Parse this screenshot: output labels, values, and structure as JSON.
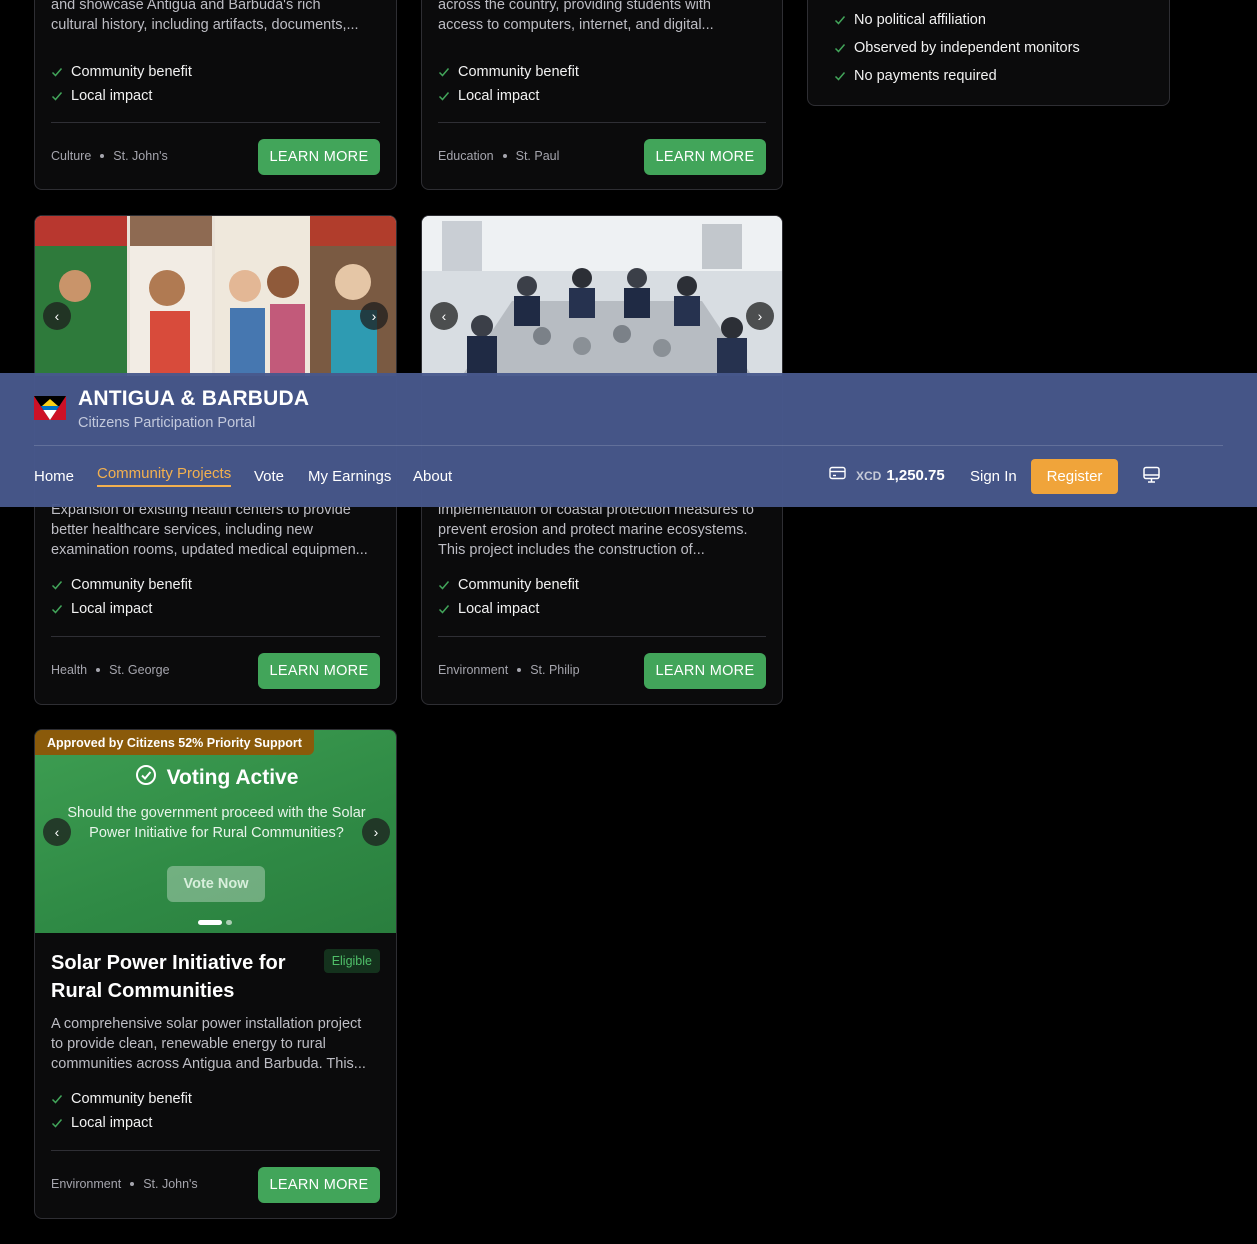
{
  "header": {
    "title": "ANTIGUA & BARBUDA",
    "subtitle": "Citizens Participation Portal",
    "nav": [
      "Home",
      "Community Projects",
      "Vote",
      "My Earnings",
      "About"
    ],
    "active_nav": "Community Projects",
    "balance_currency": "XCD",
    "balance_amount": "1,250.75",
    "sign_in": "Sign In",
    "register": "Register"
  },
  "benefits": [
    "Community benefit",
    "Local impact"
  ],
  "learn_more": "LEARN MORE",
  "side_panel": {
    "items": [
      "No political affiliation",
      "Observed by independent monitors",
      "No payments required"
    ]
  },
  "cards": [
    {
      "desc_lines": [
        "and showcase Antigua and Barbuda's rich",
        "cultural history, including artifacts, documents,..."
      ],
      "category": "Culture",
      "parish": "St. John's"
    },
    {
      "desc_lines": [
        "across the country, providing students with",
        "access to computers, internet, and digital..."
      ],
      "category": "Education",
      "parish": "St. Paul"
    },
    {
      "desc_lines": [
        "Expansion of existing health centers to provide",
        "better healthcare services, including new",
        "examination rooms, updated medical equipmen..."
      ],
      "category": "Health",
      "parish": "St. George"
    },
    {
      "desc_lines": [
        "implementation of coastal protection measures to",
        "prevent erosion and protect marine ecosystems.",
        "This project includes the construction of..."
      ],
      "category": "Environment",
      "parish": "St. Philip"
    },
    {
      "title": "Solar Power Initiative for Rural Communities",
      "badge": "Eligible",
      "desc_lines": [
        "A comprehensive solar power installation project",
        "to provide clean, renewable energy to rural",
        "communities across Antigua and Barbuda. This..."
      ],
      "category": "Environment",
      "parish": "St. John's",
      "approval_banner": "Approved by Citizens 52% Priority Support",
      "voting_title": "Voting Active",
      "voting_question": "Should the government proceed with the Solar Power Initiative for Rural Communities?",
      "vote_button": "Vote Now"
    }
  ],
  "colors": {
    "accent_green": "#42a55a",
    "nav_active": "#f3b04f",
    "register_button": "#f0a43a",
    "header_bg": "#48588c",
    "approval_banner": "#8a5a0a"
  }
}
